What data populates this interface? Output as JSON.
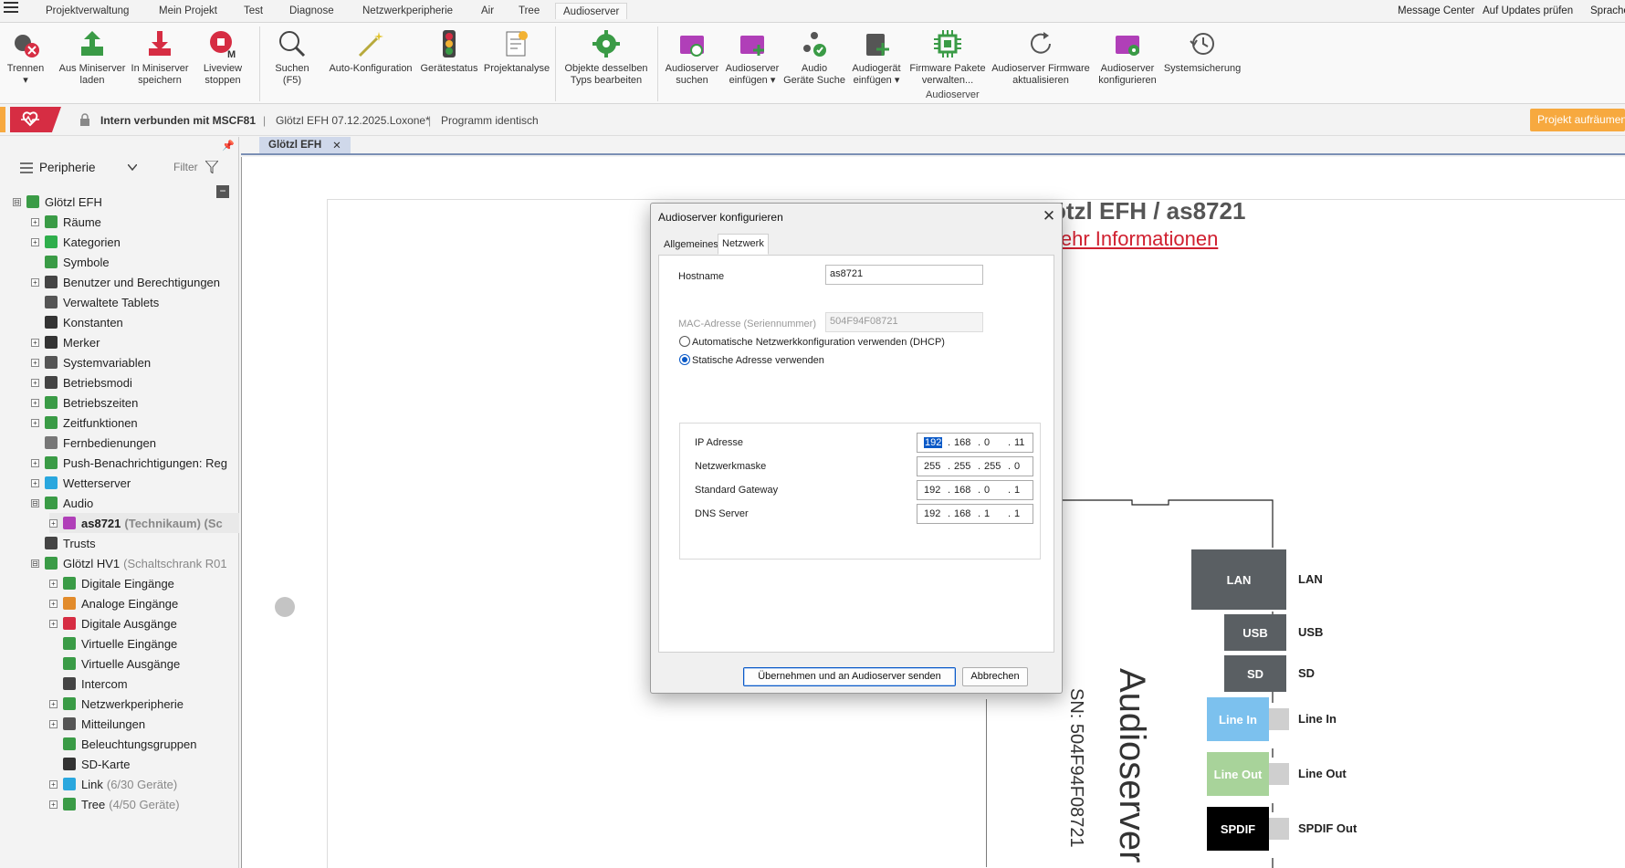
{
  "menubar": {
    "tabs": [
      "Projektverwaltung",
      "Mein Projekt",
      "Test",
      "Diagnose",
      "Netzwerkperipherie",
      "Air",
      "Tree",
      "Audioserver"
    ],
    "active_tab": "Audioserver",
    "right_links": [
      "Message Center",
      "Auf Updates prüfen",
      "Sprache"
    ]
  },
  "ribbon": {
    "buttons": [
      {
        "label": "Trennen",
        "sub": "▾"
      },
      {
        "label": "Aus Miniserver",
        "sub": "laden"
      },
      {
        "label": "In Miniserver",
        "sub": "speichern"
      },
      {
        "label": "Liveview",
        "sub": "stoppen"
      },
      {
        "label": "Suchen",
        "sub": "(F5)"
      },
      {
        "label": "Auto-Konfiguration",
        "sub": ""
      },
      {
        "label": "Gerätestatus",
        "sub": ""
      },
      {
        "label": "Projektanalyse",
        "sub": ""
      },
      {
        "label": "Objekte desselben",
        "sub": "Typs bearbeiten"
      },
      {
        "label": "Audioserver",
        "sub": "suchen"
      },
      {
        "label": "Audioserver",
        "sub": "einfügen ▾"
      },
      {
        "label": "Audio",
        "sub": "Geräte Suche"
      },
      {
        "label": "Audiogerät",
        "sub": "einfügen ▾"
      },
      {
        "label": "Firmware Pakete",
        "sub": "verwalten..."
      },
      {
        "label": "Audioserver Firmware",
        "sub": "aktualisieren"
      },
      {
        "label": "Audioserver",
        "sub": "konfigurieren"
      },
      {
        "label": "Systemsicherung",
        "sub": ""
      }
    ],
    "group_label": "Audioserver"
  },
  "statusbar": {
    "connection": "Intern verbunden mit MSCF81",
    "file": "Glötzl EFH 07.12.2025.Loxone*",
    "program": "Programm identisch",
    "cleanup_button": "Projekt aufräumen"
  },
  "leftpanel": {
    "pin": "📌",
    "header": "Peripherie",
    "filter": "Filter",
    "tree": [
      {
        "label": "Glötzl EFH",
        "sub": "",
        "level": 0,
        "exp": "⊟",
        "icon": "#3a9b46"
      },
      {
        "label": "Räume",
        "sub": "",
        "level": 1,
        "exp": "+",
        "icon": "#3a9b46"
      },
      {
        "label": "Kategorien",
        "sub": "",
        "level": 1,
        "exp": "+",
        "icon": "#2fae4c"
      },
      {
        "label": "Symbole",
        "sub": "",
        "level": 1,
        "exp": "",
        "icon": "#3a9b46"
      },
      {
        "label": "Benutzer und Berechtigungen",
        "sub": "",
        "level": 1,
        "exp": "+",
        "icon": "#444444"
      },
      {
        "label": "Verwaltete Tablets",
        "sub": "",
        "level": 1,
        "exp": "",
        "icon": "#555555"
      },
      {
        "label": "Konstanten",
        "sub": "",
        "level": 1,
        "exp": "",
        "icon": "#333333"
      },
      {
        "label": "Merker",
        "sub": "",
        "level": 1,
        "exp": "+",
        "icon": "#333333"
      },
      {
        "label": "Systemvariablen",
        "sub": "",
        "level": 1,
        "exp": "+",
        "icon": "#555555"
      },
      {
        "label": "Betriebsmodi",
        "sub": "",
        "level": 1,
        "exp": "+",
        "icon": "#444444"
      },
      {
        "label": "Betriebszeiten",
        "sub": "",
        "level": 1,
        "exp": "+",
        "icon": "#3a9b46"
      },
      {
        "label": "Zeitfunktionen",
        "sub": "",
        "level": 1,
        "exp": "+",
        "icon": "#3a9b46"
      },
      {
        "label": "Fernbedienungen",
        "sub": "",
        "level": 1,
        "exp": "",
        "icon": "#777777"
      },
      {
        "label": "Push-Benachrichtigungen: Reg",
        "sub": "",
        "level": 1,
        "exp": "+",
        "icon": "#3a9b46"
      },
      {
        "label": "Wetterserver",
        "sub": "",
        "level": 1,
        "exp": "+",
        "icon": "#2aa7de"
      },
      {
        "label": "Audio",
        "sub": "",
        "level": 1,
        "exp": "⊟",
        "icon": "#3a9b46"
      },
      {
        "label": "as8721",
        "sub": "(Technikaum) (Sc",
        "level": 2,
        "exp": "+",
        "icon": "#b03fb8",
        "bold": true
      },
      {
        "label": "Trusts",
        "sub": "",
        "level": 1,
        "exp": "",
        "icon": "#444444"
      },
      {
        "label": "Glötzl HV1",
        "sub": "(Schaltschrank R01",
        "level": 1,
        "exp": "⊟",
        "icon": "#3a9b46"
      },
      {
        "label": "Digitale Eingänge",
        "sub": "",
        "level": 2,
        "exp": "+",
        "icon": "#3a9b46"
      },
      {
        "label": "Analoge Eingänge",
        "sub": "",
        "level": 2,
        "exp": "+",
        "icon": "#e28b2b"
      },
      {
        "label": "Digitale Ausgänge",
        "sub": "",
        "level": 2,
        "exp": "+",
        "icon": "#d62d43"
      },
      {
        "label": "Virtuelle Eingänge",
        "sub": "",
        "level": 2,
        "exp": "",
        "icon": "#3a9b46"
      },
      {
        "label": "Virtuelle Ausgänge",
        "sub": "",
        "level": 2,
        "exp": "",
        "icon": "#3a9b46"
      },
      {
        "label": "Intercom",
        "sub": "",
        "level": 2,
        "exp": "",
        "icon": "#444444"
      },
      {
        "label": "Netzwerkperipherie",
        "sub": "",
        "level": 2,
        "exp": "+",
        "icon": "#3a9b46"
      },
      {
        "label": "Mitteilungen",
        "sub": "",
        "level": 2,
        "exp": "+",
        "icon": "#555555"
      },
      {
        "label": "Beleuchtungsgruppen",
        "sub": "",
        "level": 2,
        "exp": "",
        "icon": "#3a9b46"
      },
      {
        "label": "SD-Karte",
        "sub": "",
        "level": 2,
        "exp": "",
        "icon": "#333333"
      },
      {
        "label": "Link",
        "sub": "(6/30 Geräte)",
        "level": 2,
        "exp": "+",
        "icon": "#2aa7de"
      },
      {
        "label": "Tree",
        "sub": "(4/50 Geräte)",
        "level": 2,
        "exp": "+",
        "icon": "#3a9b46"
      }
    ]
  },
  "document": {
    "tab_label": "Glötzl EFH",
    "tab_close": "✕",
    "title": "ötzl EFH / as8721",
    "link": "lehr Informationen",
    "serial_vertical": "SN: 504F94F08721",
    "device_vertical": "Audioserver",
    "ports": [
      {
        "box": "LAN",
        "label": "LAN",
        "color": "#5a5f63"
      },
      {
        "box": "USB",
        "label": "USB",
        "color": "#5a5f63"
      },
      {
        "box": "SD",
        "label": "SD",
        "color": "#5a5f63"
      },
      {
        "box": "Line In",
        "label": "Line In",
        "color": "#7cc1ee"
      },
      {
        "box": "Line Out",
        "label": "Line Out",
        "color": "#a8d39a"
      },
      {
        "box": "SPDIF",
        "label": "SPDIF Out",
        "color": "#000000"
      }
    ]
  },
  "dialog": {
    "title": "Audioserver konfigurieren",
    "close": "✕",
    "tabs": [
      "Allgemeines",
      "Netzwerk"
    ],
    "active_tab": "Netzwerk",
    "hostname_label": "Hostname",
    "hostname_value": "as8721",
    "mac_label": "MAC-Adresse (Seriennummer)",
    "mac_value": "504F94F08721",
    "dhcp_label": "Automatische Netzwerkkonfiguration verwenden (DHCP)",
    "static_label": "Statische Adresse verwenden",
    "fields": [
      {
        "label": "IP Adresse",
        "octets": [
          "192",
          "168",
          "0",
          "11"
        ]
      },
      {
        "label": "Netzwerkmaske",
        "octets": [
          "255",
          "255",
          "255",
          "0"
        ]
      },
      {
        "label": "Standard Gateway",
        "octets": [
          "192",
          "168",
          "0",
          "1"
        ]
      },
      {
        "label": "DNS Server",
        "octets": [
          "192",
          "168",
          "1",
          "1"
        ]
      }
    ],
    "apply_button": "Übernehmen und an Audioserver senden",
    "cancel_button": "Abbrechen"
  }
}
